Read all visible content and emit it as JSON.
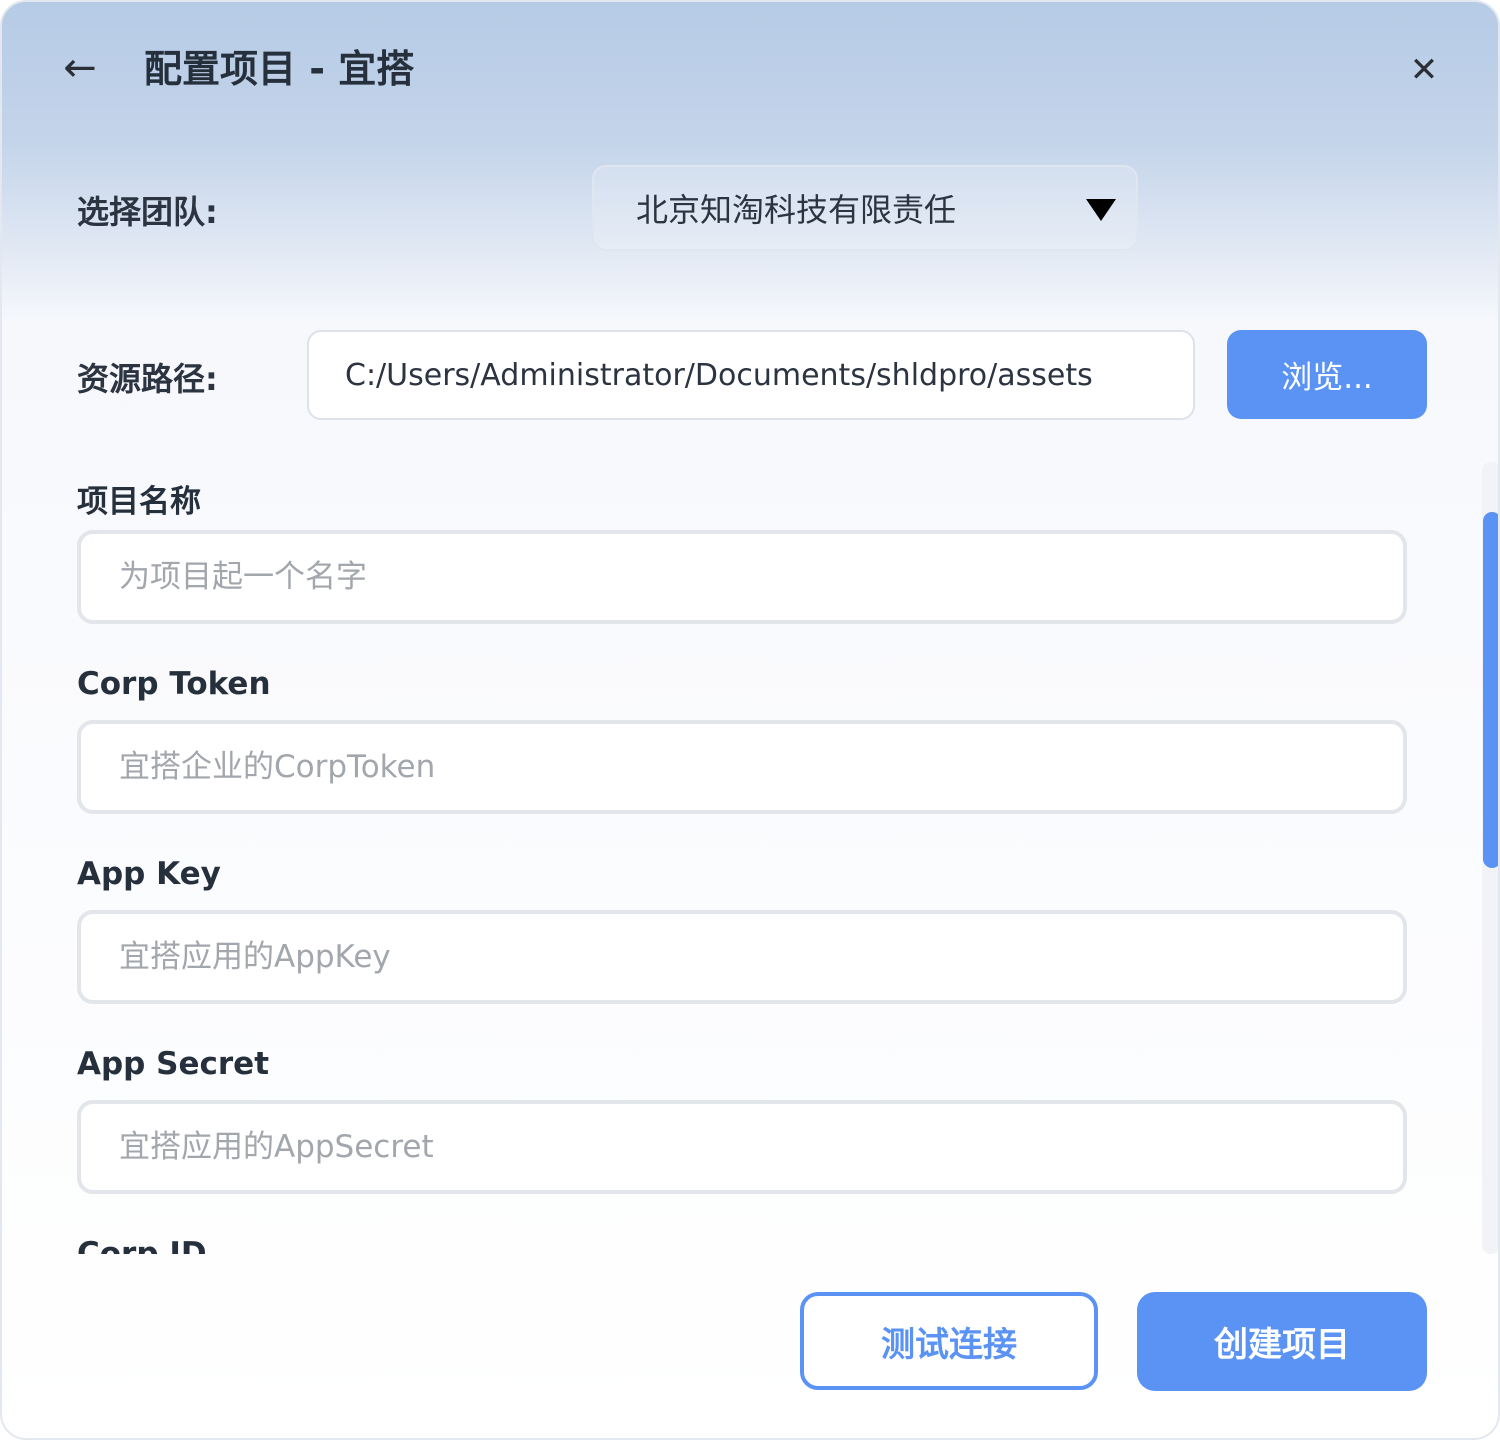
{
  "header": {
    "back_icon": "arrow-left-icon",
    "back_glyph": "←",
    "title": "配置项目 - 宜搭",
    "close_icon": "close-icon",
    "close_glyph": "✕"
  },
  "team": {
    "label": "选择团队:",
    "selected": "北京知淘科技有限责任",
    "caret_icon": "caret-down-icon"
  },
  "resource": {
    "label": "资源路径:",
    "path": "C:/Users/Administrator/Documents/shldpro/assets",
    "browse_label": "浏览..."
  },
  "fields": {
    "project_name": {
      "label": "项目名称",
      "placeholder": "为项目起一个名字"
    },
    "corp_token": {
      "label": "Corp Token",
      "placeholder": "宜搭企业的CorpToken"
    },
    "app_key": {
      "label": "App Key",
      "placeholder": "宜搭应用的AppKey"
    },
    "app_secret": {
      "label": "App Secret",
      "placeholder": "宜搭应用的AppSecret"
    },
    "corp_id": {
      "label": "Corp ID"
    }
  },
  "actions": {
    "test_label": "测试连接",
    "create_label": "创建项目"
  },
  "colors": {
    "accent": "#5b93f5",
    "text": "#26303d",
    "placeholder": "#a2a6ad"
  }
}
